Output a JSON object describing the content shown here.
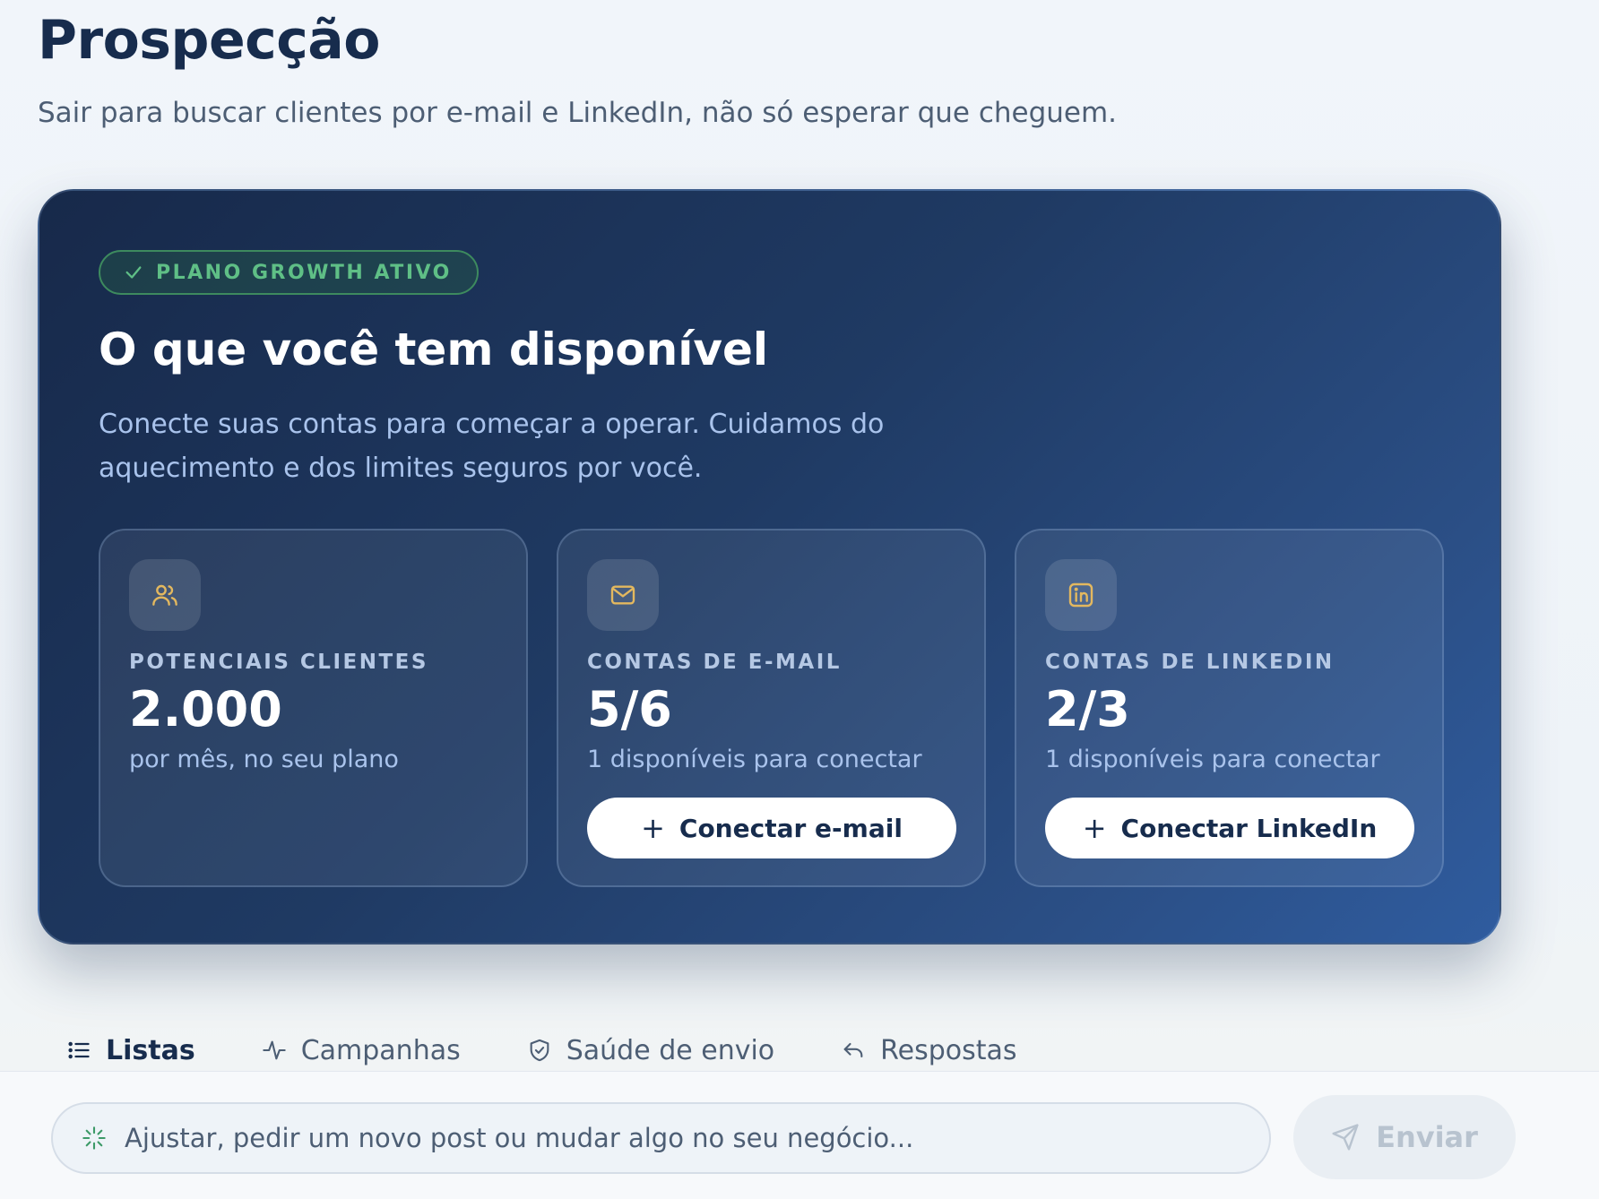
{
  "header": {
    "title": "Prospecção",
    "subtitle": "Sair para buscar clientes por e-mail e LinkedIn, não só esperar que cheguem."
  },
  "hero": {
    "badge": "PLANO GROWTH ATIVO",
    "title": "O que você tem disponível",
    "description": "Conecte suas contas para começar a operar. Cuidamos do aquecimento e dos limites seguros por você.",
    "cards": [
      {
        "icon": "users-icon",
        "label": "POTENCIAIS CLIENTES",
        "value": "2.000",
        "note": "por mês, no seu plano"
      },
      {
        "icon": "mail-icon",
        "label": "CONTAS DE E-MAIL",
        "value": "5/6",
        "note": "1 disponíveis para conectar",
        "button": "Conectar e-mail"
      },
      {
        "icon": "linkedin-icon",
        "label": "CONTAS DE LINKEDIN",
        "value": "2/3",
        "note": "1 disponíveis para conectar",
        "button": "Conectar LinkedIn"
      }
    ]
  },
  "tabs": [
    {
      "label": "Listas",
      "icon": "list-icon",
      "active": true
    },
    {
      "label": "Campanhas",
      "icon": "activity-icon",
      "active": false
    },
    {
      "label": "Saúde de envio",
      "icon": "shield-icon",
      "active": false
    },
    {
      "label": "Respostas",
      "icon": "reply-icon",
      "active": false
    }
  ],
  "chat": {
    "placeholder": "Ajustar, pedir um novo post ou mudar algo no seu negócio...",
    "send_label": "Enviar"
  },
  "colors": {
    "accent_gold": "#e3b85f",
    "badge_green": "#5fbf86",
    "hero_navy": "#17294a"
  }
}
